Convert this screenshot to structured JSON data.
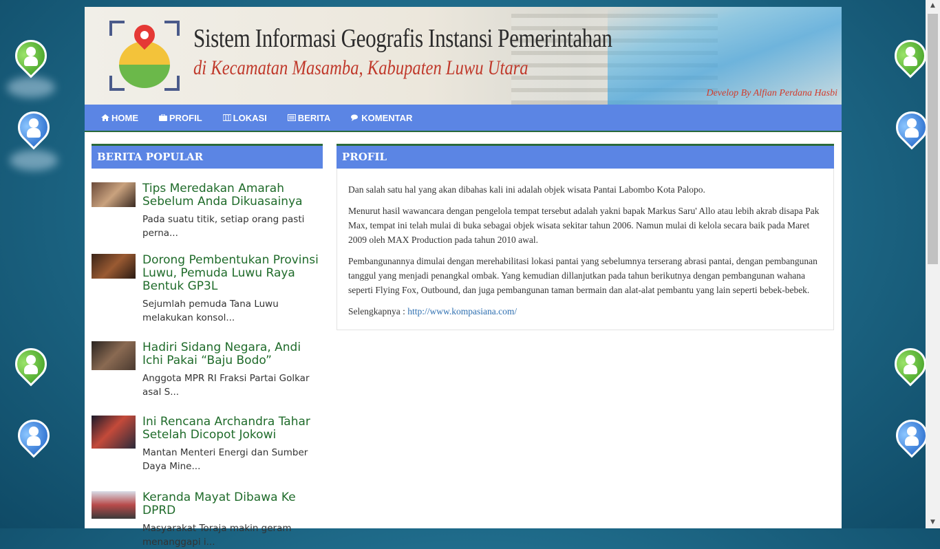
{
  "header": {
    "title": "Sistem Informasi Geografis Instansi Pemerintahan",
    "subtitle": "di Kecamatan Masamba, Kabupaten Luwu Utara",
    "developer": "Develop By Alfian Perdana Hasbi"
  },
  "nav": [
    {
      "label": "HOME",
      "icon": "home-icon"
    },
    {
      "label": "PROFIL",
      "icon": "briefcase-icon"
    },
    {
      "label": "LOKASI",
      "icon": "map-icon"
    },
    {
      "label": "BERITA",
      "icon": "newspaper-icon"
    },
    {
      "label": "KOMENTAR",
      "icon": "comments-icon"
    }
  ],
  "sidebar": {
    "title": "BERITA POPULAR",
    "posts": [
      {
        "title": "Tips Meredakan Amarah Sebelum Anda Dikuasainya",
        "excerpt": "Pada suatu titik, setiap orang pasti perna..."
      },
      {
        "title": "Dorong Pembentukan Provinsi Luwu, Pemuda Luwu Raya Bentuk GP3L",
        "excerpt": "Sejumlah pemuda Tana Luwu melakukan konsol..."
      },
      {
        "title": "Hadiri Sidang Negara, Andi Ichi Pakai “Baju Bodo”",
        "excerpt": "Anggota MPR RI Fraksi Partai Golkar asal S..."
      },
      {
        "title": "Ini Rencana Archandra Tahar Setelah Dicopot Jokowi",
        "excerpt": "Mantan Menteri Energi dan Sumber Daya Mine..."
      },
      {
        "title": "Keranda Mayat Dibawa Ke DPRD",
        "excerpt": "Masyarakat Toraja makin geram menanggapi i..."
      }
    ]
  },
  "main": {
    "title": "PROFIL",
    "paragraphs": [
      "Dan salah satu hal yang akan dibahas kali ini adalah objek wisata Pantai Labombo Kota Palopo.",
      "Menurut hasil wawancara dengan pengelola tempat tersebut adalah yakni bapak Markus Saru' Allo atau lebih akrab disapa Pak Max, tempat ini telah mulai di buka sebagai objek wisata sekitar tahun 2006. Namun mulai di kelola secara baik pada Maret 2009 oleh MAX Production pada tahun 2010 awal.",
      "Pembangunannya dimulai dengan merehabilitasi lokasi pantai yang sebelumnya terserang abrasi pantai, dengan pembangunan tanggul yang menjadi penangkal ombak. Yang kemudian dillanjutkan pada tahun berikutnya dengan pembangunan wahana seperti Flying Fox, Outbound, dan juga pembangunan taman bermain dan alat-alat pembantu yang lain seperti bebek-bebek."
    ],
    "source_label": "Selengkapnya : ",
    "source_link": "http://www.kompasiana.com/"
  },
  "colors": {
    "nav_bg": "#5b85e4",
    "title_green": "#1f6b2a",
    "accent_red": "#c0392b"
  }
}
